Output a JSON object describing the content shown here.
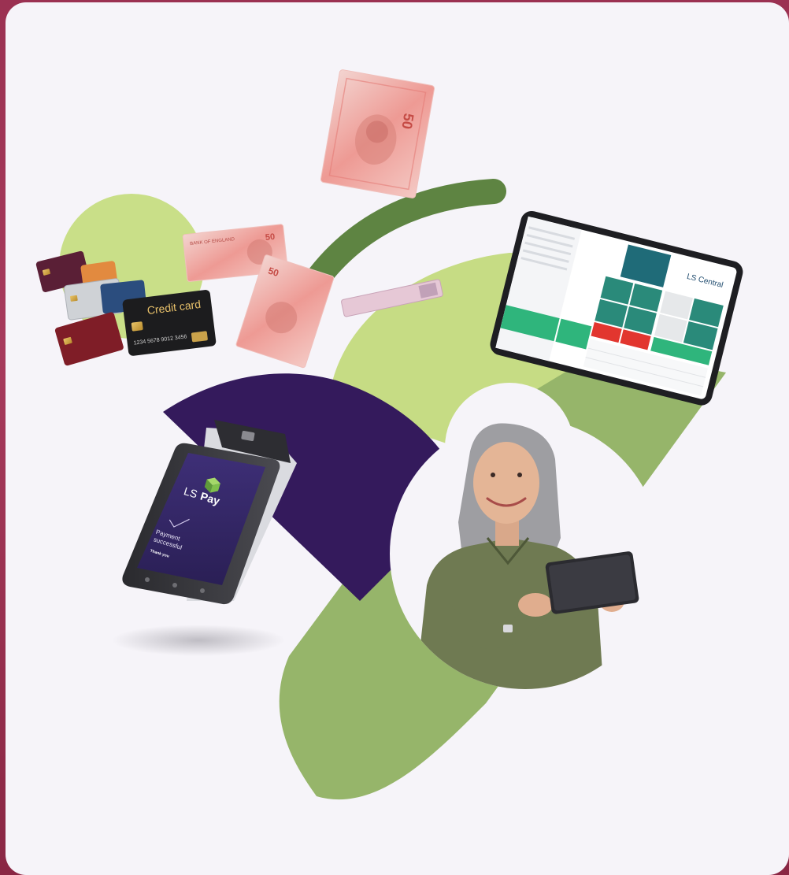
{
  "colors": {
    "frame": "#9b3152",
    "card_bg": "#f6f4f9",
    "dark_purple": "#341a5c",
    "dark_green": "#5e8442",
    "mid_green": "#96b56a",
    "light_green": "#c6dc84",
    "pale_green": "#c9df88",
    "tablet_teal": "#1f6b78",
    "tablet_green": "#2fb57c",
    "tablet_red": "#e2362f"
  },
  "credit_card": {
    "label": "Credit card",
    "number": "1234 5678 9012 3456"
  },
  "terminal": {
    "brand": "LS Pay",
    "brand_prefix": "LS",
    "brand_suffix": "Pay",
    "status_line1": "Payment",
    "status_line2": "successful",
    "thanks": "Thank you"
  },
  "pos_tablet": {
    "logo": "LS Central"
  },
  "banknote": {
    "header": "BANK OF ENGLAND"
  }
}
